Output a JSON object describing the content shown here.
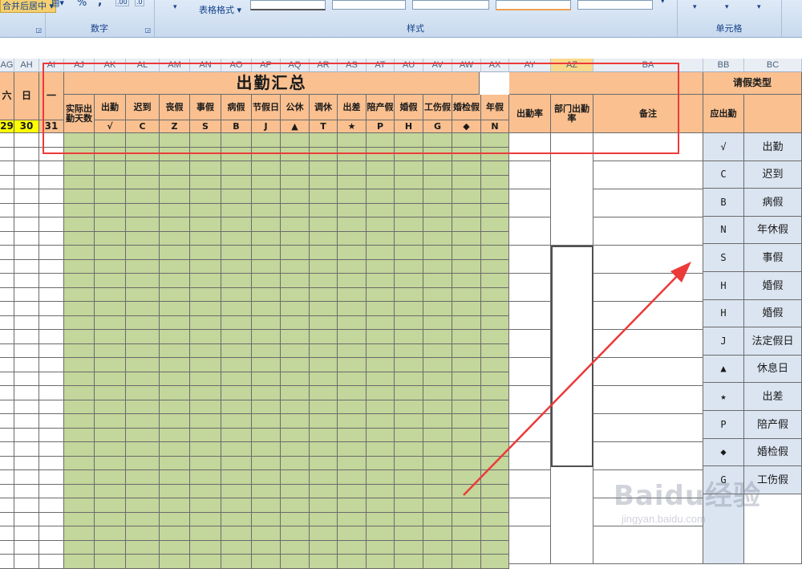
{
  "ribbon": {
    "number_group_label": "数字",
    "styles_group_label": "样式",
    "cells_group_label": "单元格",
    "merge_center_label": "合并后居中",
    "percent_symbol": "%",
    "comma_symbol": ",",
    "inc_decimal_label": ".00",
    "dec_decimal_label": ".0",
    "table_format_label": "表格格式",
    "dropdown_glyph": "▾"
  },
  "columns": [
    {
      "id": "col-ag",
      "label": "AG"
    },
    {
      "id": "col-ah",
      "label": "AH"
    },
    {
      "id": "col-ai",
      "label": "AI"
    },
    {
      "id": "col-aj",
      "label": "AJ"
    },
    {
      "id": "col-ak",
      "label": "AK"
    },
    {
      "id": "col-al",
      "label": "AL"
    },
    {
      "id": "col-am",
      "label": "AM"
    },
    {
      "id": "col-an",
      "label": "AN"
    },
    {
      "id": "col-ao",
      "label": "AO"
    },
    {
      "id": "col-ap",
      "label": "AP"
    },
    {
      "id": "col-aq",
      "label": "AQ"
    },
    {
      "id": "col-ar",
      "label": "AR"
    },
    {
      "id": "col-as",
      "label": "AS"
    },
    {
      "id": "col-at",
      "label": "AT"
    },
    {
      "id": "col-au",
      "label": "AU"
    },
    {
      "id": "col-av",
      "label": "AV"
    },
    {
      "id": "col-aw",
      "label": "AW"
    },
    {
      "id": "col-ax",
      "label": "AX"
    },
    {
      "id": "col-ay",
      "label": "AY"
    },
    {
      "id": "col-az",
      "label": "AZ"
    },
    {
      "id": "col-ba",
      "label": "BA"
    },
    {
      "id": "col-bb",
      "label": "BB"
    },
    {
      "id": "col-bc",
      "label": "BC"
    }
  ],
  "selected_column": "AZ",
  "sheet": {
    "summary_title": "出勤汇总",
    "weekday_sat": "六",
    "weekday_sun": "日",
    "weekday_mon": "一",
    "date_29": "29",
    "date_30": "30",
    "date_31": "31",
    "actual_days_header": "实际出勤天数",
    "attendance_rate_header": "出勤率",
    "dept_rate_header": "部门出勤率",
    "remarks_header": "备注",
    "leave_types_header": "请假类型",
    "should_attend_header": "应出勤",
    "categories": [
      {
        "id": "cat-chuqin",
        "label": "出勤",
        "code": "√"
      },
      {
        "id": "cat-chidao",
        "label": "迟到",
        "code": "C"
      },
      {
        "id": "cat-sangjia",
        "label": "丧假",
        "code": "Z"
      },
      {
        "id": "cat-shijia",
        "label": "事假",
        "code": "S"
      },
      {
        "id": "cat-bingjia",
        "label": "病假",
        "code": "B"
      },
      {
        "id": "cat-jiejiari",
        "label": "节假日",
        "code": "J"
      },
      {
        "id": "cat-gongxiu",
        "label": "公休",
        "code": "▲"
      },
      {
        "id": "cat-tiaoxiu",
        "label": "调休",
        "code": "T"
      },
      {
        "id": "cat-chuchai",
        "label": "出差",
        "code": "★"
      },
      {
        "id": "cat-peichanjia",
        "label": "陪产假",
        "code": "P"
      },
      {
        "id": "cat-hunjia",
        "label": "婚假",
        "code": "H"
      },
      {
        "id": "cat-gongshangjia",
        "label": "工伤假",
        "code": "G"
      },
      {
        "id": "cat-hunjianjia",
        "label": "婚检假",
        "code": "◆"
      },
      {
        "id": "cat-nianjia",
        "label": "年假",
        "code": "N"
      }
    ]
  },
  "legend": [
    {
      "code": "√",
      "name": "出勤"
    },
    {
      "code": "C",
      "name": "迟到"
    },
    {
      "code": "B",
      "name": "病假"
    },
    {
      "code": "N",
      "name": "年休假"
    },
    {
      "code": "S",
      "name": "事假"
    },
    {
      "code": "H",
      "name": "婚假"
    },
    {
      "code": "H",
      "name": "婚假"
    },
    {
      "code": "J",
      "name": "法定假日"
    },
    {
      "code": "▲",
      "name": "休息日"
    },
    {
      "code": "★",
      "name": "出差"
    },
    {
      "code": "P",
      "name": "陪产假"
    },
    {
      "code": "◆",
      "name": "婚检假"
    },
    {
      "code": "G",
      "name": "工伤假"
    }
  ],
  "watermark": {
    "main": "Baidu经验",
    "sub": "jingyan.baidu.com"
  },
  "colors": {
    "header_orange": "#fac090",
    "data_green": "#c3d69b",
    "date_yellow": "#ffff00",
    "legend_blue": "#dbe5f1",
    "annotation_red": "#ec3a3a"
  }
}
